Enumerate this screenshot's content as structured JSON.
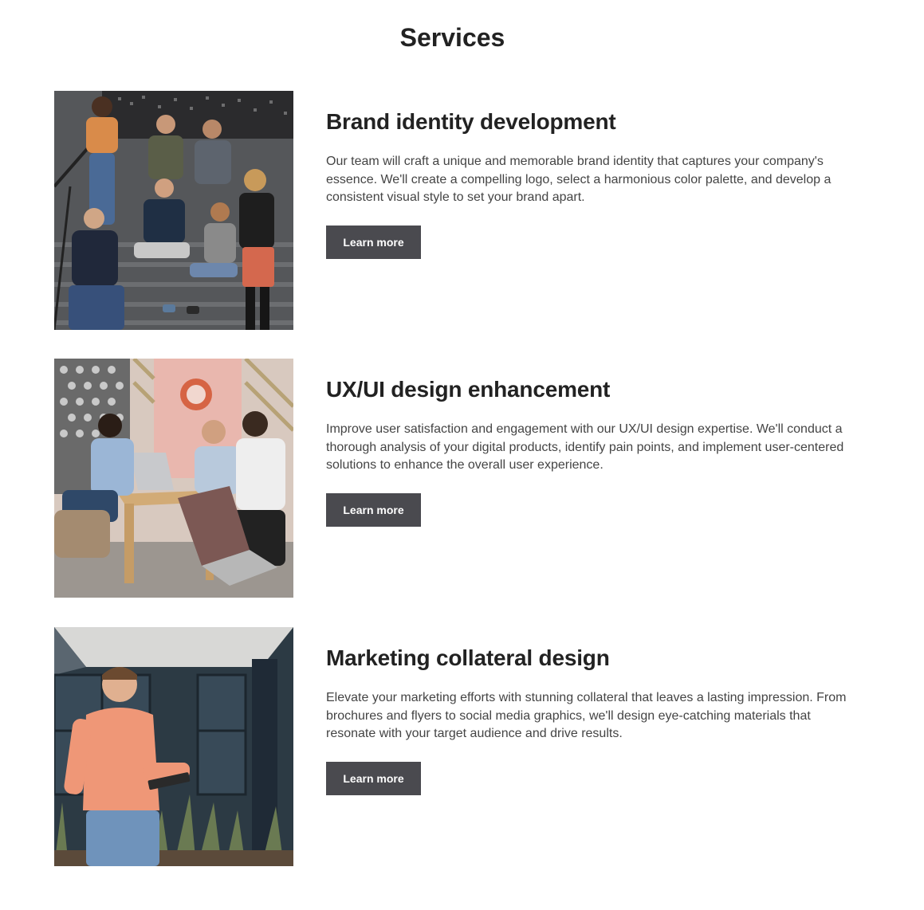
{
  "page": {
    "title": "Services"
  },
  "services": [
    {
      "heading": "Brand identity development",
      "description": "Our team will craft a unique and memorable brand identity that captures your company's essence. We'll create a compelling logo, select a harmonious color palette, and develop a consistent visual style to set your brand apart.",
      "button_label": "Learn more",
      "image_icon": "team-on-stairs-photo"
    },
    {
      "heading": "UX/UI design enhancement",
      "description": "Improve user satisfaction and engagement with our UX/UI design expertise. We'll conduct a thorough analysis of your digital products, identify pain points, and implement user-centered solutions to enhance the overall user experience.",
      "button_label": "Learn more",
      "image_icon": "team-meeting-laptops-photo"
    },
    {
      "heading": "Marketing collateral design",
      "description": "Elevate your marketing efforts with stunning collateral that leaves a lasting impression. From brochures and flyers to social media graphics, we'll design eye-catching materials that resonate with your target audience and drive results.",
      "button_label": "Learn more",
      "image_icon": "man-with-tablet-photo"
    }
  ],
  "colors": {
    "button_bg": "#4a4a4f",
    "button_text": "#ffffff",
    "heading": "#222222",
    "body_text": "#444444"
  }
}
